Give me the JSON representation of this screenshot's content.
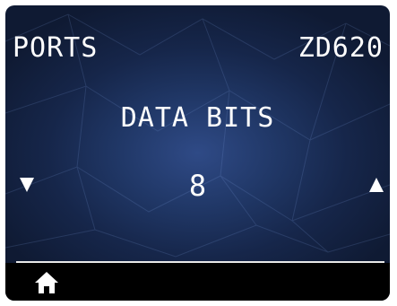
{
  "header": {
    "title": "PORTS",
    "model": "ZD620"
  },
  "setting": {
    "label": "DATA BITS",
    "value": "8"
  },
  "controls": {
    "decrement_icon": "down-triangle-icon",
    "increment_icon": "up-triangle-icon",
    "home_icon": "home-icon"
  },
  "colors": {
    "background_center": "#2f4a86",
    "background_edge": "#0f1a33",
    "text": "#ffffff",
    "bottom_bar": "#000000"
  }
}
